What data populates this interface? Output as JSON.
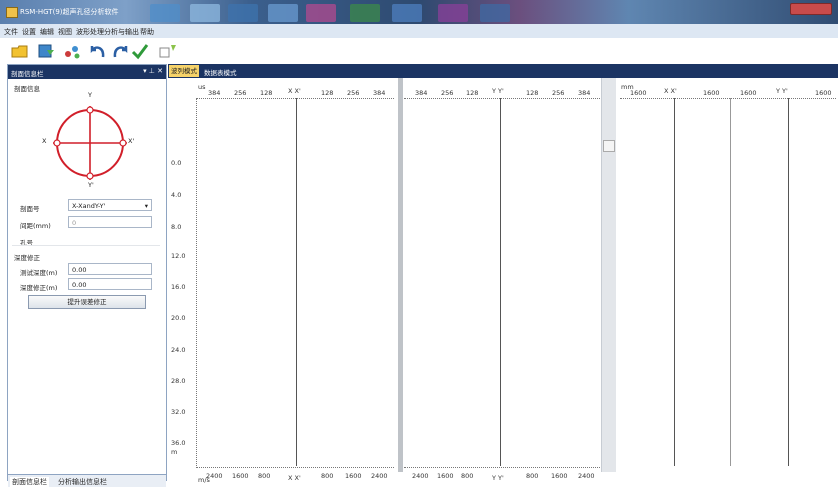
{
  "window": {
    "title": "RSM-HGT(9)超声孔径分析软件"
  },
  "menu": [
    "文件",
    "设置",
    "编辑",
    "视图",
    "波形处理",
    "分析与输出",
    "帮助"
  ],
  "toolbar_icons": [
    "open-folder-icon",
    "save-export-icon",
    "tree-icon",
    "undo-icon",
    "redo-icon",
    "check-icon",
    "monitor-icon"
  ],
  "left_panel": {
    "header": "剖面信息栏",
    "controls": "▾ ⊥ ✕",
    "section": "剖面信息",
    "diagram_labels": {
      "top": "Y",
      "bottom": "Y'",
      "left": "X",
      "right": "X'"
    },
    "fields": {
      "profile_label": "剖面号",
      "profile_value": "X-XandY-Y'",
      "spacing_label": "间距(mm)",
      "spacing_value": "0",
      "hole_label": "孔号",
      "depth_section": "深度修正",
      "test_depth_label": "测试深度(m)",
      "test_depth_value": "0.00",
      "depth_fix_label": "深度修正(m)",
      "depth_fix_value": "0.00",
      "apply_button": "提升误差修正"
    },
    "bottom_tabs": [
      "剖面信息栏",
      "分析输出信息栏"
    ]
  },
  "tabs": {
    "active": "波列模式",
    "other": "数据表模式"
  },
  "plot": {
    "top_unit_left": "us",
    "top_unit_right": "mm",
    "top_ticks_a": [
      "384",
      "256",
      "128"
    ],
    "label_xx": "X  X'",
    "top_ticks_b": [
      "128",
      "256",
      "384"
    ],
    "top_ticks_c": [
      "384",
      "256",
      "128"
    ],
    "label_yy": "Y  Y'",
    "top_ticks_d": [
      "128",
      "256",
      "384"
    ],
    "right_ticks": [
      "1600",
      "1600",
      "1600"
    ],
    "right_label_xx": "X  X'",
    "right_label_yy": "Y  Y'",
    "depths": [
      "0.0",
      "4.0",
      "8.0",
      "12.0",
      "16.0",
      "20.0",
      "24.0",
      "28.0",
      "32.0",
      "36.0"
    ],
    "depth_unit": "m",
    "bottom_unit": "m/s",
    "bottom_ticks_a": [
      "2400",
      "1600",
      "800"
    ],
    "bottom_ticks_b": [
      "800",
      "1600",
      "2400"
    ],
    "bottom_ticks_c": [
      "2400",
      "1600",
      "800"
    ],
    "bottom_ticks_d": [
      "800",
      "1600",
      "2400"
    ]
  }
}
